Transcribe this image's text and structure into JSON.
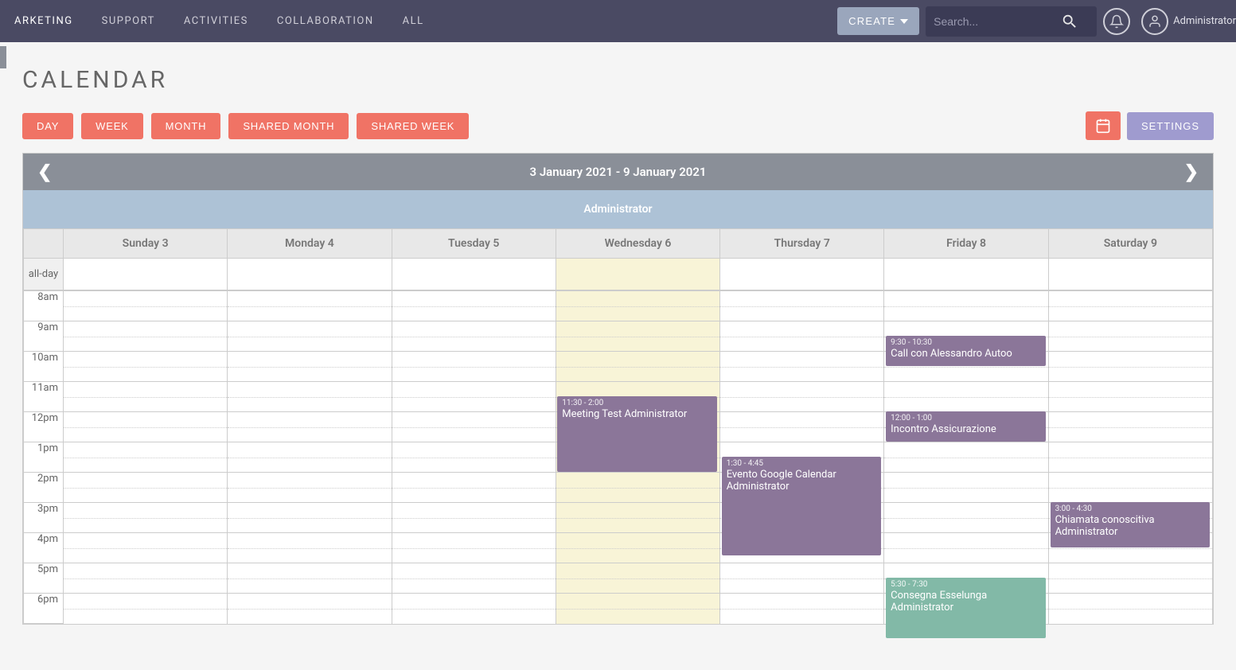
{
  "nav": {
    "items": [
      "ARKETING",
      "SUPPORT",
      "ACTIVITIES",
      "COLLABORATION",
      "ALL"
    ]
  },
  "header": {
    "create_label": "CREATE",
    "search_placeholder": "Search...",
    "username": "Administrator"
  },
  "page": {
    "title": "CALENDAR"
  },
  "views": {
    "buttons": [
      "DAY",
      "WEEK",
      "MONTH",
      "SHARED MONTH",
      "SHARED WEEK"
    ],
    "settings_label": "SETTINGS"
  },
  "calendar": {
    "range_title": "3 January 2021 - 9 January 2021",
    "owner": "Administrator",
    "all_day_label": "all-day",
    "days": [
      "Sunday 3",
      "Monday 4",
      "Tuesday 5",
      "Wednesday 6",
      "Thursday 7",
      "Friday 8",
      "Saturday 9"
    ],
    "today_index": 3,
    "hours": [
      "8am",
      "9am",
      "10am",
      "11am",
      "12pm",
      "1pm",
      "2pm",
      "3pm",
      "4pm",
      "5pm",
      "6pm"
    ],
    "events": [
      {
        "day": 3,
        "start_hour": 11.5,
        "end_hour": 14.0,
        "time": "11:30 - 2:00",
        "title": "Meeting Test Administrator",
        "color": "default"
      },
      {
        "day": 4,
        "start_hour": 13.5,
        "end_hour": 16.75,
        "time": "1:30 - 4:45",
        "title": "Evento Google Calendar Administrator",
        "color": "default"
      },
      {
        "day": 5,
        "start_hour": 9.5,
        "end_hour": 10.5,
        "time": "9:30 - 10:30",
        "title": "Call con Alessandro Autoo",
        "color": "default"
      },
      {
        "day": 5,
        "start_hour": 12.0,
        "end_hour": 13.0,
        "time": "12:00 - 1:00",
        "title": "Incontro Assicurazione",
        "color": "default"
      },
      {
        "day": 5,
        "start_hour": 17.5,
        "end_hour": 19.5,
        "time": "5:30 - 7:30",
        "title": "Consegna Esselunga Administrator",
        "color": "alt"
      },
      {
        "day": 6,
        "start_hour": 15.0,
        "end_hour": 16.5,
        "time": "3:00 - 4:30",
        "title": "Chiamata conoscitiva Administrator",
        "color": "default"
      }
    ]
  }
}
